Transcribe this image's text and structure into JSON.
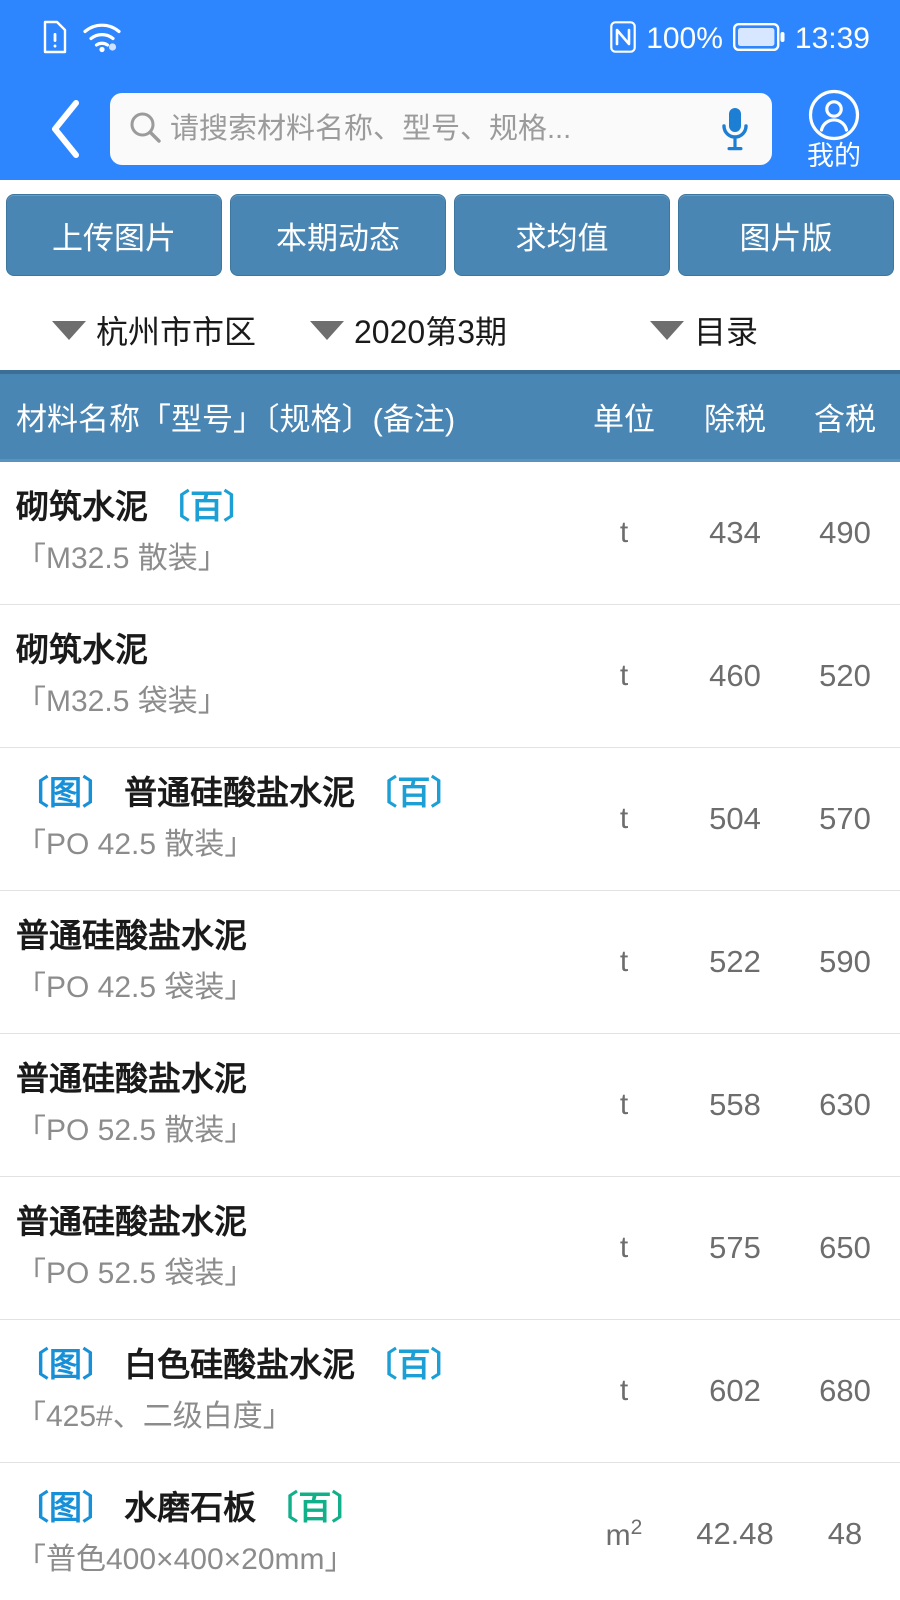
{
  "statusbar": {
    "icons_left": [
      "sim-alert-icon",
      "wifi-icon"
    ],
    "nfc_icon": "nfc-icon",
    "battery_percent": "100%",
    "battery_icon": "battery-full-icon",
    "time": "13:39"
  },
  "navbar": {
    "back_icon": "back-chevron-icon",
    "search": {
      "icon": "search-icon",
      "value": "",
      "placeholder": "请搜索材料名称、型号、规格..."
    },
    "mic_icon": "microphone-icon",
    "profile": {
      "icon": "user-avatar-icon",
      "label": "我的"
    }
  },
  "actions": [
    {
      "label": "上传图片"
    },
    {
      "label": "本期动态"
    },
    {
      "label": "求均值"
    },
    {
      "label": "图片版"
    }
  ],
  "filters": [
    {
      "label": "杭州市市区"
    },
    {
      "label": "2020第3期"
    },
    {
      "label": "目录"
    }
  ],
  "table": {
    "columns": {
      "name": "材料名称「型号」〔规格〕(备注)",
      "unit": "单位",
      "excl_tax": "除税",
      "incl_tax": "含税"
    },
    "rows": [
      {
        "img_tag": "",
        "name": "砌筑水泥",
        "bai_tag": "〔百〕",
        "bai_color": "blue",
        "spec": "「M32.5 散装」",
        "unit": "t",
        "excl_tax": "434",
        "incl_tax": "490"
      },
      {
        "img_tag": "",
        "name": "砌筑水泥",
        "bai_tag": "",
        "bai_color": "blue",
        "spec": "「M32.5 袋装」",
        "unit": "t",
        "excl_tax": "460",
        "incl_tax": "520"
      },
      {
        "img_tag": "〔图〕",
        "name": "普通硅酸盐水泥",
        "bai_tag": "〔百〕",
        "bai_color": "blue",
        "spec": "「PO 42.5 散装」",
        "unit": "t",
        "excl_tax": "504",
        "incl_tax": "570"
      },
      {
        "img_tag": "",
        "name": "普通硅酸盐水泥",
        "bai_tag": "",
        "bai_color": "blue",
        "spec": "「PO 42.5 袋装」",
        "unit": "t",
        "excl_tax": "522",
        "incl_tax": "590"
      },
      {
        "img_tag": "",
        "name": "普通硅酸盐水泥",
        "bai_tag": "",
        "bai_color": "blue",
        "spec": "「PO 52.5 散装」",
        "unit": "t",
        "excl_tax": "558",
        "incl_tax": "630"
      },
      {
        "img_tag": "",
        "name": "普通硅酸盐水泥",
        "bai_tag": "",
        "bai_color": "blue",
        "spec": "「PO 52.5 袋装」",
        "unit": "t",
        "excl_tax": "575",
        "incl_tax": "650"
      },
      {
        "img_tag": "〔图〕",
        "name": "白色硅酸盐水泥",
        "bai_tag": "〔百〕",
        "bai_color": "blue",
        "spec": "「425#、二级白度」",
        "unit": "t",
        "excl_tax": "602",
        "incl_tax": "680"
      },
      {
        "img_tag": "〔图〕",
        "name": "水磨石板",
        "bai_tag": "〔百〕",
        "bai_color": "green",
        "spec": "「普色400×400×20mm」",
        "unit": "m²",
        "excl_tax": "42.48",
        "incl_tax": "48"
      }
    ]
  },
  "colors": {
    "header_blue": "#2E86FF",
    "button_blue": "#4A86B4",
    "tag_blue": "#1C9FD4",
    "tag_green": "#12B08A",
    "text_gray": "#8c8c8c"
  }
}
